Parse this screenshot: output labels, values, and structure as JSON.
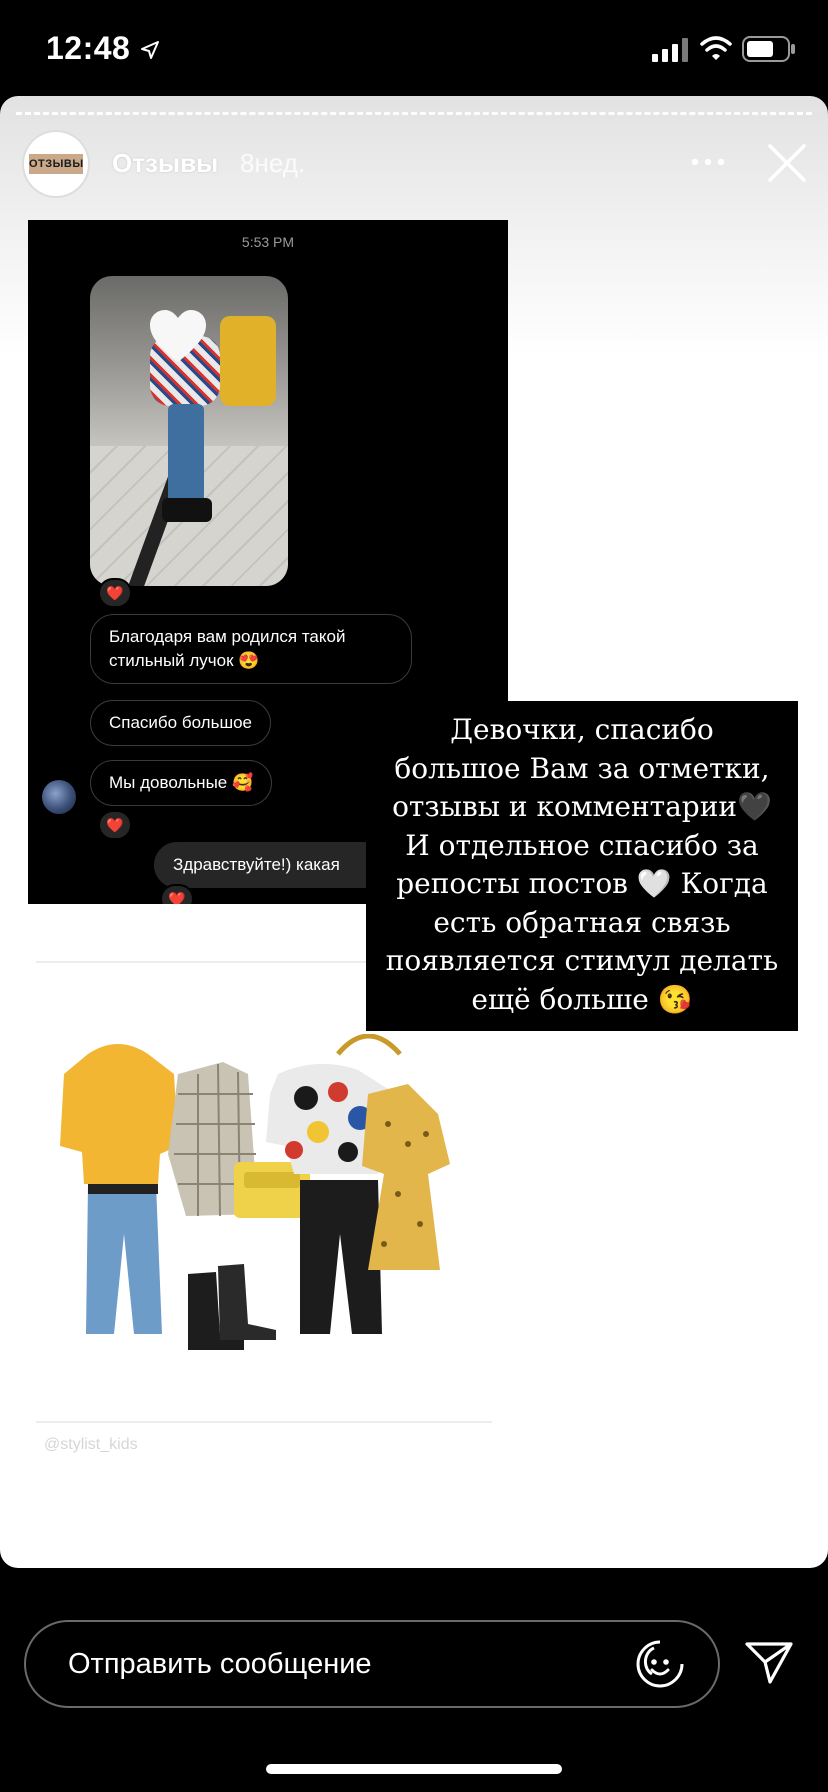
{
  "status_bar": {
    "time": "12:48"
  },
  "story": {
    "avatar_label": "ОТЗЫВЫ",
    "username": "Отзывы",
    "time_ago": "8нед."
  },
  "chat": {
    "timestamp": "5:53 PM",
    "messages": [
      {
        "text": "Благодаря вам родился такой стильный лучок 😍"
      },
      {
        "text": "Спасибо большое"
      },
      {
        "text": "Мы довольные 🥰"
      },
      {
        "text": "Здравствуйте!) какая"
      }
    ],
    "reaction": "❤️"
  },
  "collage": {
    "watermark": "@stylist_kids"
  },
  "overlay": {
    "lines": [
      "Девочки, спасибо",
      "большое Вам за отметки,",
      "отзывы и комментарии🖤",
      "И отдельное спасибо за",
      "репосты постов 🤍 Когда",
      "есть обратная связь",
      "появляется стимул делать",
      "ещё больше 😘"
    ]
  },
  "reply": {
    "placeholder": "Отправить сообщение"
  },
  "icons": {
    "more": "more-horizontal-icon",
    "close": "close-icon",
    "emoji": "sticker-emoji-icon",
    "send": "send-icon"
  }
}
